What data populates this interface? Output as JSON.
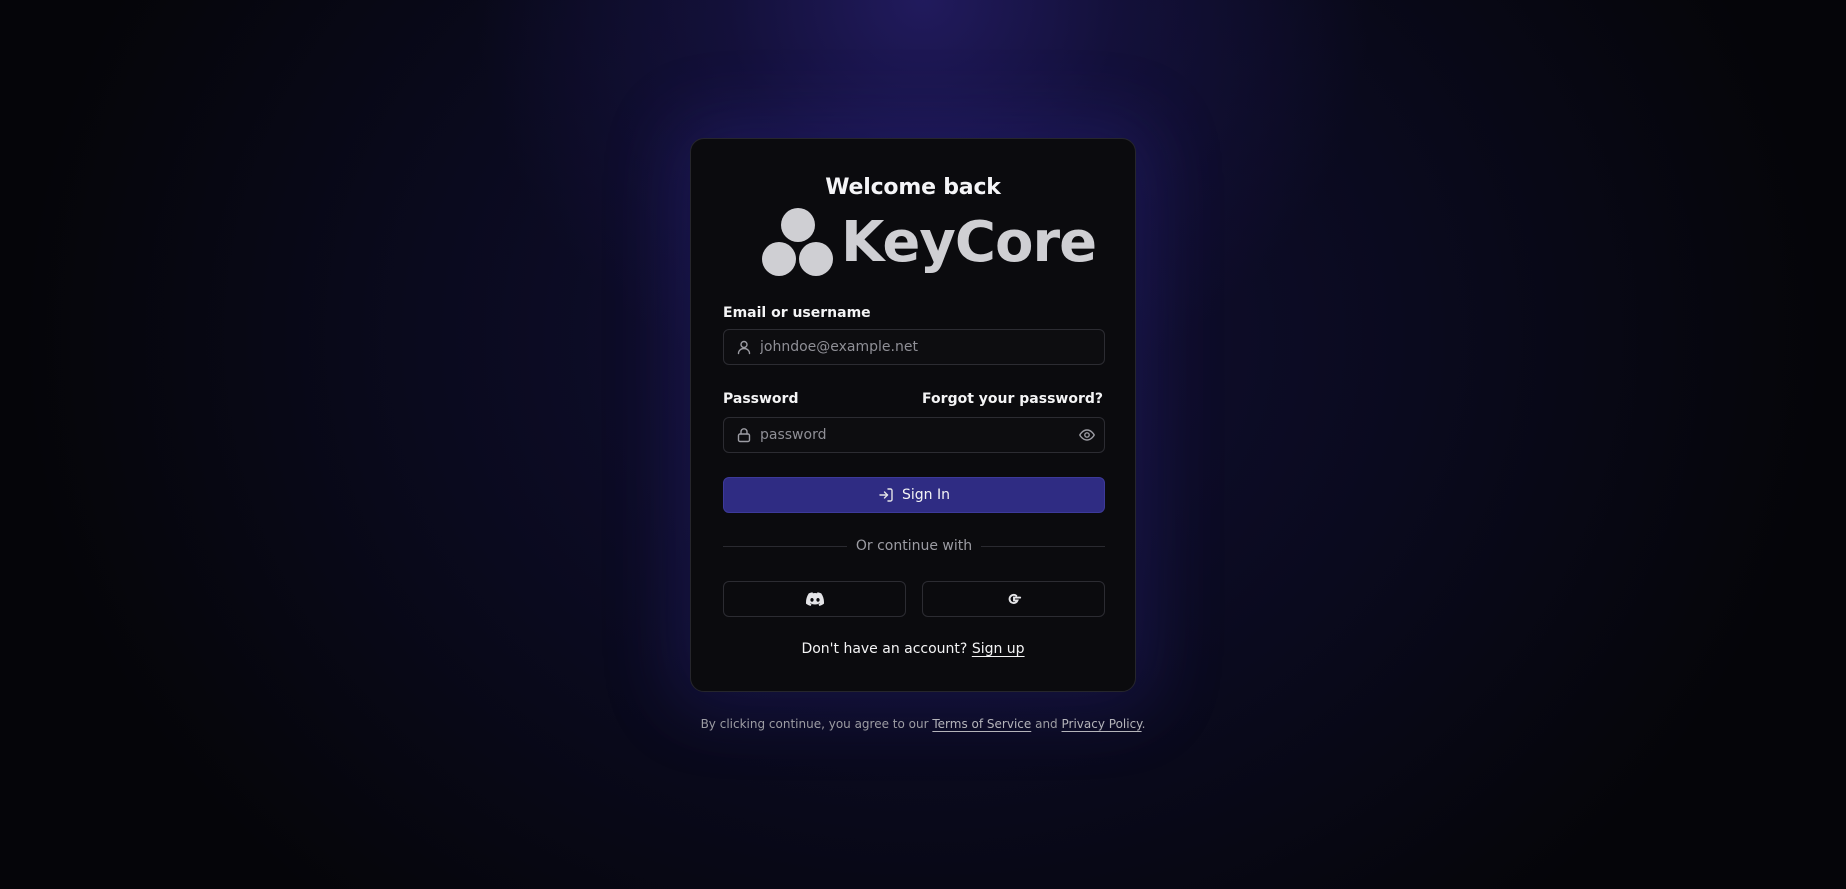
{
  "login": {
    "title": "Welcome back",
    "brand": {
      "name": "KeyCore",
      "logo_icon": "three-circles-logo",
      "color": "#cfcfd3"
    },
    "email": {
      "label": "Email or username",
      "placeholder": "johndoe@example.net",
      "value": "",
      "icon": "user-icon"
    },
    "password": {
      "label": "Password",
      "placeholder": "password",
      "value": "",
      "icon": "lock-icon",
      "toggle_icon": "eye-icon",
      "forgot_label": "Forgot your password?"
    },
    "signin_button": {
      "label": "Sign In",
      "icon": "log-in-icon",
      "color": "#2f2c83"
    },
    "divider_text": "Or continue with",
    "social": [
      {
        "provider": "Discord",
        "icon": "discord-icon"
      },
      {
        "provider": "Google",
        "icon": "google-icon"
      }
    ],
    "signup": {
      "prompt": "Don't have an account?",
      "link": "Sign up"
    }
  },
  "legal": {
    "prefix": "By clicking continue, you agree to our",
    "terms": "Terms of Service",
    "and": "and",
    "privacy": "Privacy Policy",
    "suffix": "."
  },
  "colors": {
    "background": "#050509",
    "card": "#0b0b0e",
    "accent": "#2f2c83",
    "glow": "#3c32b4"
  }
}
